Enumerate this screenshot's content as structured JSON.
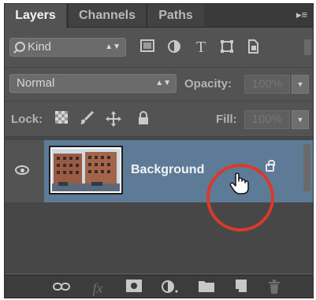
{
  "tabs": [
    {
      "label": "Layers",
      "active": true
    },
    {
      "label": "Channels",
      "active": false
    },
    {
      "label": "Paths",
      "active": false
    }
  ],
  "panel_menu_icon": "panel-menu-icon",
  "filter": {
    "kind_label": "Kind",
    "filter_icons": [
      "image-filter-icon",
      "adjustment-filter-icon",
      "type-filter-icon",
      "shape-filter-icon",
      "smart-object-filter-icon"
    ]
  },
  "blend": {
    "mode": "Normal",
    "opacity_label": "Opacity:",
    "opacity_value": "100%"
  },
  "lock": {
    "label": "Lock:",
    "icons": [
      "lock-transparent-pixels-icon",
      "lock-image-pixels-icon",
      "lock-position-icon",
      "lock-all-icon"
    ],
    "fill_label": "Fill:",
    "fill_value": "100%"
  },
  "layers": [
    {
      "name": "Background",
      "visible": true,
      "locked": true,
      "selected": true
    }
  ],
  "bottom_icons": [
    "link-layers-icon",
    "fx-icon",
    "add-mask-icon",
    "adjustment-layer-icon",
    "new-group-icon",
    "new-layer-icon",
    "trash-icon"
  ],
  "colors": {
    "selection": "#5d7a96",
    "highlight_circle": "#d93b2b"
  }
}
